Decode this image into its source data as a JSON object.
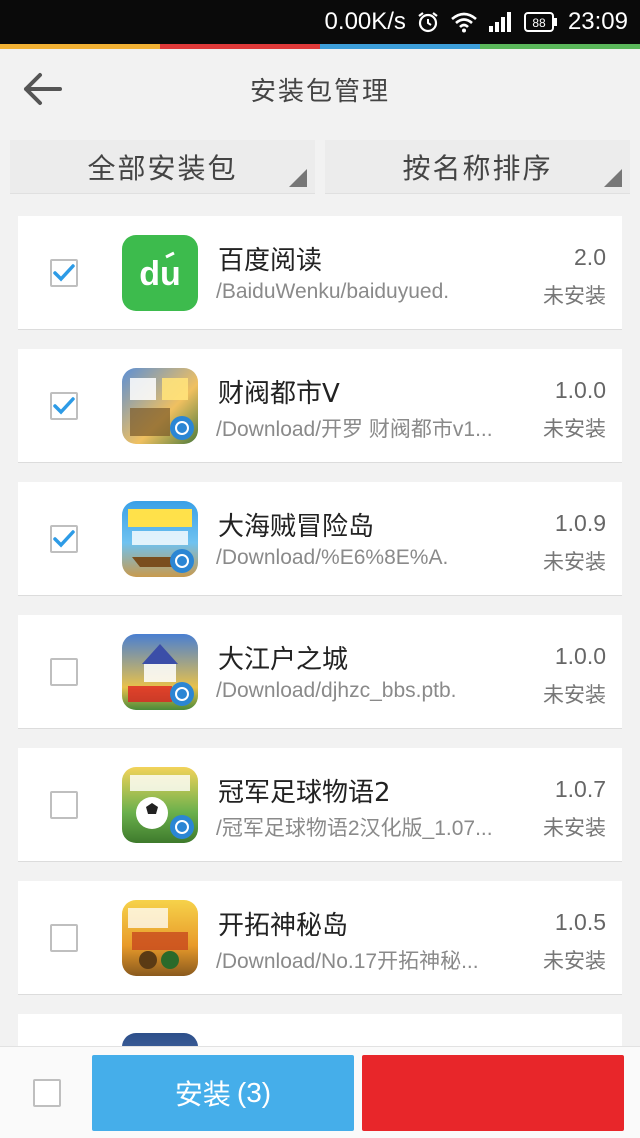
{
  "status_bar": {
    "speed": "0.00K/s",
    "battery": "88",
    "time": "23:09"
  },
  "colors": {
    "install_blue": "#45aeea",
    "delete_red": "#e8262a",
    "check_blue": "#2d9be6",
    "stripe": [
      "#f2b134",
      "#e03a3a",
      "#3c9ed9",
      "#5bb85b"
    ]
  },
  "header": {
    "title": "安装包管理",
    "back_icon": "arrow-left-icon"
  },
  "filters": {
    "scope_label": "全部安装包",
    "sort_label": "按名称排序"
  },
  "apps": [
    {
      "name": "百度阅读",
      "path": "/BaiduWenku/baiduyued.",
      "version": "2.0",
      "status": "未安装",
      "checked": true,
      "icon": "baidu-read-icon"
    },
    {
      "name": "财阀都市Ⅴ",
      "path": "/Download/开罗 财阀都市v1...",
      "version": "1.0.0",
      "status": "未安装",
      "checked": true,
      "icon": "game-icon"
    },
    {
      "name": "大海贼冒险岛",
      "path": "/Download/%E6%8E%A.",
      "version": "1.0.9",
      "status": "未安装",
      "checked": true,
      "icon": "game-icon"
    },
    {
      "name": "大江户之城",
      "path": "/Download/djhzc_bbs.ptb.",
      "version": "1.0.0",
      "status": "未安装",
      "checked": false,
      "icon": "game-icon"
    },
    {
      "name": "冠军足球物语2",
      "path": "/冠军足球物语2汉化版_1.07...",
      "version": "1.0.7",
      "status": "未安装",
      "checked": false,
      "icon": "game-icon"
    },
    {
      "name": "开拓神秘岛",
      "path": "/Download/No.17开拓神秘...",
      "version": "1.0.5",
      "status": "未安装",
      "checked": false,
      "icon": "game-icon"
    }
  ],
  "bottom_bar": {
    "install_label": "安装",
    "install_count": "(3)",
    "delete_label": ""
  }
}
